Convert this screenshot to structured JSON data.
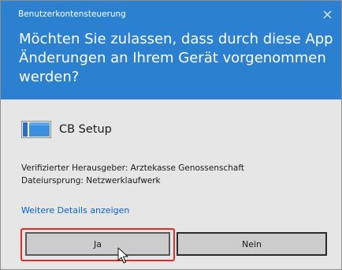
{
  "dialog": {
    "title": "Benutzerkontensteuerung",
    "question": "Möchten Sie zulassen, dass durch diese App Änderungen an Ihrem Gerät vorgenommen werden?",
    "app_name": "CB Setup",
    "publisher_line": "Verifizierter Herausgeber: Arztekasse Genossenschaft",
    "origin_line": "Dateiursprung: Netzwerklaufwerk",
    "details_link": "Weitere Details anzeigen",
    "yes_label": "Ja",
    "no_label": "Nein",
    "close_symbol": "×"
  },
  "icons": {
    "app": "setup-app-icon",
    "close": "close-icon",
    "cursor": "mouse-pointer-icon"
  },
  "colors": {
    "header_bg": "#2b80cf",
    "body_bg": "#e6e6e6",
    "link": "#0a62c4",
    "highlight": "#e22a27"
  }
}
